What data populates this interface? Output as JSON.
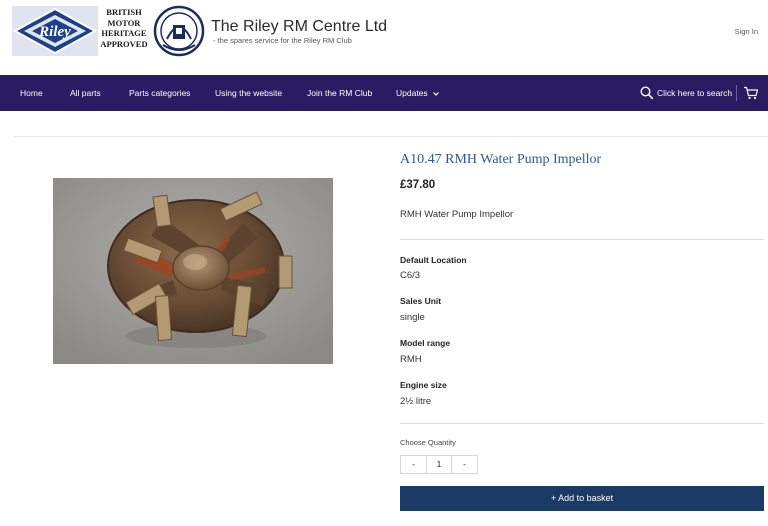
{
  "header": {
    "badge_lines": [
      "BRITISH",
      "MOTOR",
      "HERITAGE",
      "APPROVED"
    ],
    "riley_logo_text": "Riley",
    "site_title": "The Riley RM Centre Ltd",
    "site_subtitle": "- the spares service for the Riley RM Club",
    "sign_in": "Sign In"
  },
  "nav": {
    "items": [
      "Home",
      "All parts",
      "Parts categories",
      "Using the website",
      "Join the RM Club",
      "Updates"
    ],
    "search_label": "Click here to search",
    "icons": [
      "search-icon",
      "cart-icon",
      "chevron-down-icon"
    ],
    "bar_color": "#2a1c63"
  },
  "product": {
    "title": "A10.47 RMH Water Pump Impellor",
    "price": "£37.80",
    "description": "RMH Water Pump Impellor",
    "attributes": [
      {
        "label": "Default Location",
        "value": "C6/3"
      },
      {
        "label": "Sales Unit",
        "value": "single"
      },
      {
        "label": "Model range",
        "value": "RMH"
      },
      {
        "label": "Engine size",
        "value": "2½ litre"
      }
    ],
    "quantity_label": "Choose Quantity",
    "quantity": "1",
    "decrement": "-",
    "increment": "-",
    "add_button": "+ Add to basket",
    "title_color": "#2e5a8a",
    "button_color": "#1c3a66"
  }
}
